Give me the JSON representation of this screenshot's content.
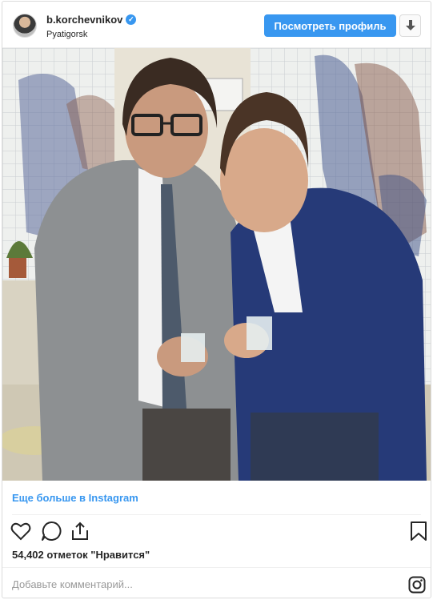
{
  "post": {
    "username": "b.korchevnikov",
    "location": "Pyatigorsk",
    "view_profile_label": "Посмотреть профиль",
    "more_link": "Еще больше в Instagram",
    "likes": "54,402 отметок \"Нравится\"",
    "comment_placeholder": "Добавьте комментарий..."
  },
  "icons": {
    "verified": "verified-badge-icon",
    "download": "download-icon",
    "like": "heart-icon",
    "comment": "comment-icon",
    "share": "share-icon",
    "save": "bookmark-icon",
    "brand": "instagram-logo-icon"
  },
  "colors": {
    "accent": "#3897f0",
    "text": "#262626",
    "muted": "#999999",
    "border": "#dbdbdb"
  }
}
